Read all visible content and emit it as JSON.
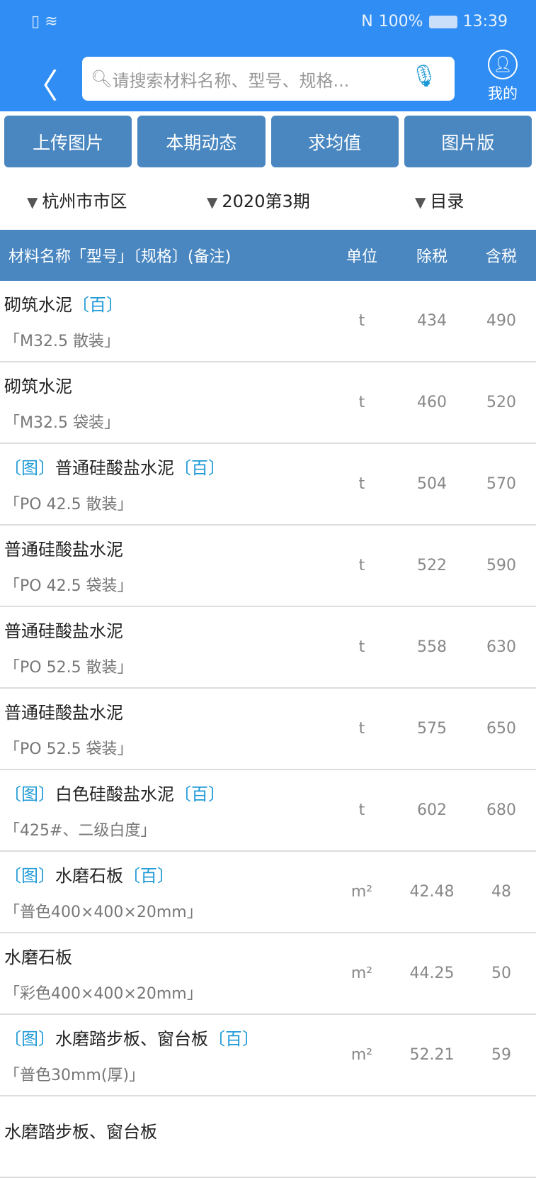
{
  "status": {
    "battery": "100%",
    "time": "13:39",
    "nfc": "N"
  },
  "header": {
    "search_placeholder": "请搜索材料名称、型号、规格...",
    "me_label": "我的"
  },
  "buttons": [
    "上传图片",
    "本期动态",
    "求均值",
    "图片版"
  ],
  "filters": {
    "region": "杭州市市区",
    "period": "2020第3期",
    "catalog": "目录"
  },
  "table": {
    "headers": [
      "材料名称「型号」〔规格〕(备注)",
      "单位",
      "除税",
      "含税"
    ],
    "rows": [
      {
        "pre": "",
        "name": "砌筑水泥",
        "post": "〔百〕",
        "spec": "「M32.5 散装」",
        "unit": "t",
        "ex": "434",
        "inc": "490"
      },
      {
        "pre": "",
        "name": "砌筑水泥",
        "post": "",
        "spec": "「M32.5 袋装」",
        "unit": "t",
        "ex": "460",
        "inc": "520"
      },
      {
        "pre": "〔图〕",
        "name": "普通硅酸盐水泥",
        "post": "〔百〕",
        "spec": "「PO 42.5 散装」",
        "unit": "t",
        "ex": "504",
        "inc": "570"
      },
      {
        "pre": "",
        "name": "普通硅酸盐水泥",
        "post": "",
        "spec": "「PO 42.5 袋装」",
        "unit": "t",
        "ex": "522",
        "inc": "590"
      },
      {
        "pre": "",
        "name": "普通硅酸盐水泥",
        "post": "",
        "spec": "「PO 52.5 散装」",
        "unit": "t",
        "ex": "558",
        "inc": "630"
      },
      {
        "pre": "",
        "name": "普通硅酸盐水泥",
        "post": "",
        "spec": "「PO 52.5 袋装」",
        "unit": "t",
        "ex": "575",
        "inc": "650"
      },
      {
        "pre": "〔图〕",
        "name": "白色硅酸盐水泥",
        "post": "〔百〕",
        "spec": "「425#、二级白度」",
        "unit": "t",
        "ex": "602",
        "inc": "680"
      },
      {
        "pre": "〔图〕",
        "name": "水磨石板",
        "post": "〔百〕",
        "spec": "「普色400×400×20mm」",
        "unit": "m²",
        "ex": "42.48",
        "inc": "48"
      },
      {
        "pre": "",
        "name": "水磨石板",
        "post": "",
        "spec": "「彩色400×400×20mm」",
        "unit": "m²",
        "ex": "44.25",
        "inc": "50"
      },
      {
        "pre": "〔图〕",
        "name": "水磨踏步板、窗台板",
        "post": "〔百〕",
        "spec": "「普色30mm(厚)」",
        "unit": "m²",
        "ex": "52.21",
        "inc": "59"
      },
      {
        "pre": "",
        "name": "水磨踏步板、窗台板",
        "post": "",
        "spec": "",
        "unit": "",
        "ex": "",
        "inc": ""
      }
    ]
  }
}
